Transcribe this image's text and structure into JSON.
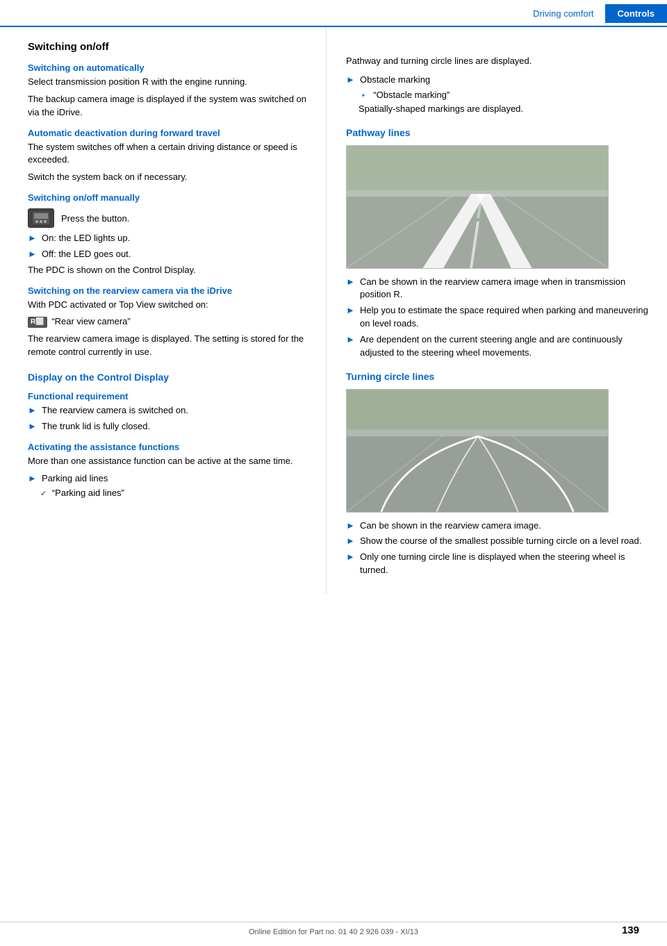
{
  "header": {
    "driving_comfort": "Driving comfort",
    "controls": "Controls"
  },
  "page_number": "139",
  "footer_text": "Online Edition for Part no. 01 40 2 926 039 - XI/13",
  "left_col": {
    "main_title": "Switching on/off",
    "sections": [
      {
        "id": "switching-on-automatically",
        "title": "Switching on automatically",
        "paragraphs": [
          "Select transmission position R with the engine running.",
          "The backup camera image is displayed if the system was switched on via the iDrive."
        ]
      },
      {
        "id": "automatic-deactivation",
        "title": "Automatic deactivation during forward travel",
        "paragraphs": [
          "The system switches off when a certain driving distance or speed is exceeded.",
          "Switch the system back on if necessary."
        ]
      },
      {
        "id": "switching-on-off-manually",
        "title": "Switching on/off manually",
        "icon_label": "Press the button.",
        "bullets": [
          "On: the LED lights up.",
          "Off: the LED goes out."
        ],
        "pdc_text": "The PDC is shown on the Control Display."
      },
      {
        "id": "switching-rearview-camera",
        "title": "Switching on the rearview camera via the iDrive",
        "paragraphs": [
          "With PDC activated or Top View switched on:",
          "“Rear view camera”",
          "The rearview camera image is displayed. The setting is stored for the remote control currently in use."
        ]
      },
      {
        "id": "display-control-display",
        "title": "Display on the Control Display",
        "subsections": [
          {
            "id": "functional-requirement",
            "title": "Functional requirement",
            "bullets": [
              "The rearview camera is switched on.",
              "The trunk lid is fully closed."
            ]
          },
          {
            "id": "activating-assistance",
            "title": "Activating the assistance functions",
            "paragraphs": [
              "More than one assistance function can be active at the same time."
            ],
            "bullets": [
              {
                "text": "Parking aid lines",
                "sub": "“Parking aid lines”"
              }
            ]
          }
        ]
      }
    ]
  },
  "right_col": {
    "intro_paragraphs": [
      "Pathway and turning circle lines are displayed."
    ],
    "obstacle_marking": {
      "title": "Obstacle marking",
      "sub": "“Obstacle marking”",
      "text": "Spatially-shaped markings are displayed."
    },
    "pathway_lines": {
      "title": "Pathway lines",
      "bullets": [
        "Can be shown in the rearview camera image when in transmission position R.",
        "Help you to estimate the space required when parking and maneuvering on level roads.",
        "Are dependent on the current steering angle and are continuously adjusted to the steering wheel movements."
      ]
    },
    "turning_circle_lines": {
      "title": "Turning circle lines",
      "bullets": [
        "Can be shown in the rearview camera image.",
        "Show the course of the smallest possible turning circle on a level road.",
        "Only one turning circle line is displayed when the steering wheel is turned."
      ]
    }
  }
}
